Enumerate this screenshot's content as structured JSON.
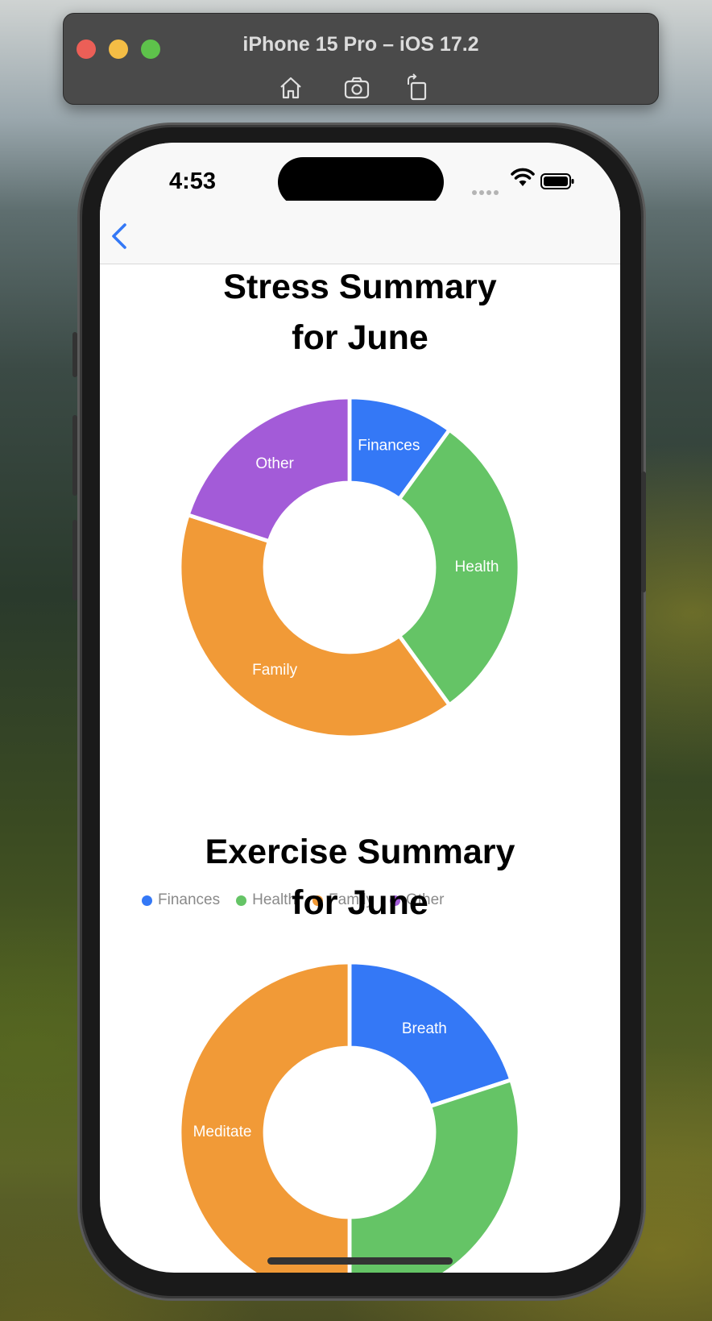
{
  "simulator": {
    "title": "iPhone 15 Pro – iOS 17.2",
    "tools": [
      "home-icon",
      "screenshot-icon",
      "rotate-icon"
    ]
  },
  "status_bar": {
    "time": "4:53"
  },
  "nav": {
    "back_icon": "chevron-left-icon"
  },
  "stress": {
    "title": "Stress Summary\nfor June",
    "chart_data": {
      "type": "pie",
      "title": "Stress Summary for June",
      "categories": [
        "Finances",
        "Health",
        "Family",
        "Other"
      ],
      "values": [
        10,
        30,
        40,
        20
      ],
      "colors": [
        "#3478f6",
        "#65c466",
        "#f19a37",
        "#a35bd8"
      ],
      "legend": "bottom-left",
      "donut": true
    }
  },
  "exercise": {
    "title": "Exercise Summary\nfor June",
    "chart_data": {
      "type": "pie",
      "title": "Exercise Summary for June",
      "categories": [
        "Breath",
        "",
        "Meditate"
      ],
      "values": [
        20,
        30,
        50
      ],
      "colors": [
        "#3478f6",
        "#65c466",
        "#f19a37"
      ],
      "donut": true
    }
  }
}
